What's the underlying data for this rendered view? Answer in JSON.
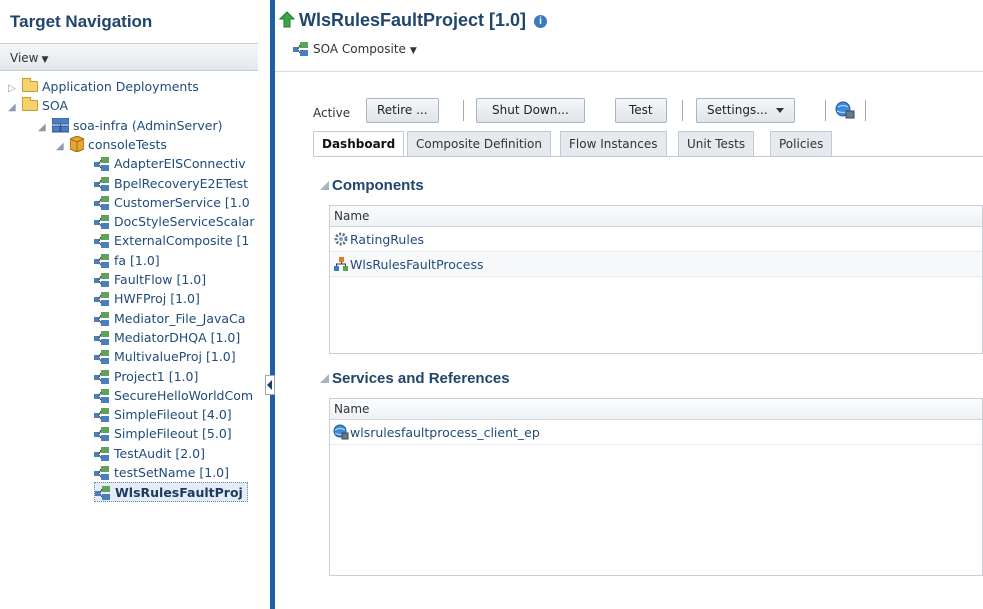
{
  "nav": {
    "title": "Target Navigation",
    "view_label": "View",
    "tree": [
      {
        "label": "Application Deployments",
        "level": 0,
        "icon": "folder-icon",
        "disclosure": "collapsed"
      },
      {
        "label": "SOA",
        "level": 0,
        "icon": "folder-icon",
        "disclosure": "expanded"
      },
      {
        "label": "soa-infra (AdminServer)",
        "level": 1,
        "icon": "server-icon",
        "disclosure": "expanded"
      },
      {
        "label": "consoleTests",
        "level": 2,
        "icon": "partition-icon",
        "disclosure": "expanded"
      },
      {
        "label": "AdapterEISConnectiv",
        "level": 3,
        "icon": "composite-icon"
      },
      {
        "label": "BpelRecoveryE2ETest",
        "level": 3,
        "icon": "composite-icon"
      },
      {
        "label": "CustomerService [1.0",
        "level": 3,
        "icon": "composite-icon"
      },
      {
        "label": "DocStyleServiceScalar",
        "level": 3,
        "icon": "composite-icon"
      },
      {
        "label": "ExternalComposite [1",
        "level": 3,
        "icon": "composite-icon"
      },
      {
        "label": "fa [1.0]",
        "level": 3,
        "icon": "composite-icon"
      },
      {
        "label": "FaultFlow [1.0]",
        "level": 3,
        "icon": "composite-icon"
      },
      {
        "label": "HWFProj [1.0]",
        "level": 3,
        "icon": "composite-icon"
      },
      {
        "label": "Mediator_File_JavaCa",
        "level": 3,
        "icon": "composite-icon"
      },
      {
        "label": "MediatorDHQA [1.0]",
        "level": 3,
        "icon": "composite-icon"
      },
      {
        "label": "MultivalueProj [1.0]",
        "level": 3,
        "icon": "composite-icon"
      },
      {
        "label": "Project1 [1.0]",
        "level": 3,
        "icon": "composite-icon"
      },
      {
        "label": "SecureHelloWorldCom",
        "level": 3,
        "icon": "composite-icon"
      },
      {
        "label": "SimpleFileout [4.0]",
        "level": 3,
        "icon": "composite-icon"
      },
      {
        "label": "SimpleFileout [5.0]",
        "level": 3,
        "icon": "composite-icon"
      },
      {
        "label": "TestAudit [2.0]",
        "level": 3,
        "icon": "composite-icon"
      },
      {
        "label": "testSetName [1.0]",
        "level": 3,
        "icon": "composite-icon"
      },
      {
        "label": "WlsRulesFaultProj",
        "level": 3,
        "icon": "composite-icon",
        "selected": true
      }
    ]
  },
  "header": {
    "title": "WlsRulesFaultProject [1.0]",
    "menu_label": "SOA Composite"
  },
  "toolbar": {
    "status": "Active",
    "retire": "Retire ...",
    "shutdown": "Shut Down...",
    "test": "Test",
    "settings": "Settings..."
  },
  "tabs": [
    "Dashboard",
    "Composite Definition",
    "Flow Instances",
    "Unit Tests",
    "Policies"
  ],
  "components": {
    "title": "Components",
    "column": "Name",
    "rows": [
      {
        "name": "RatingRules",
        "icon": "business-rules-icon"
      },
      {
        "name": "WlsRulesFaultProcess",
        "icon": "bpel-process-icon"
      }
    ]
  },
  "services": {
    "title": "Services and References",
    "column": "Name",
    "rows": [
      {
        "name": "wlsrulesfaultprocess_client_ep",
        "icon": "web-service-icon"
      }
    ]
  },
  "colors": {
    "title": "#20466c",
    "link": "#1f4b7a",
    "splitter": "#1f5ea8"
  }
}
